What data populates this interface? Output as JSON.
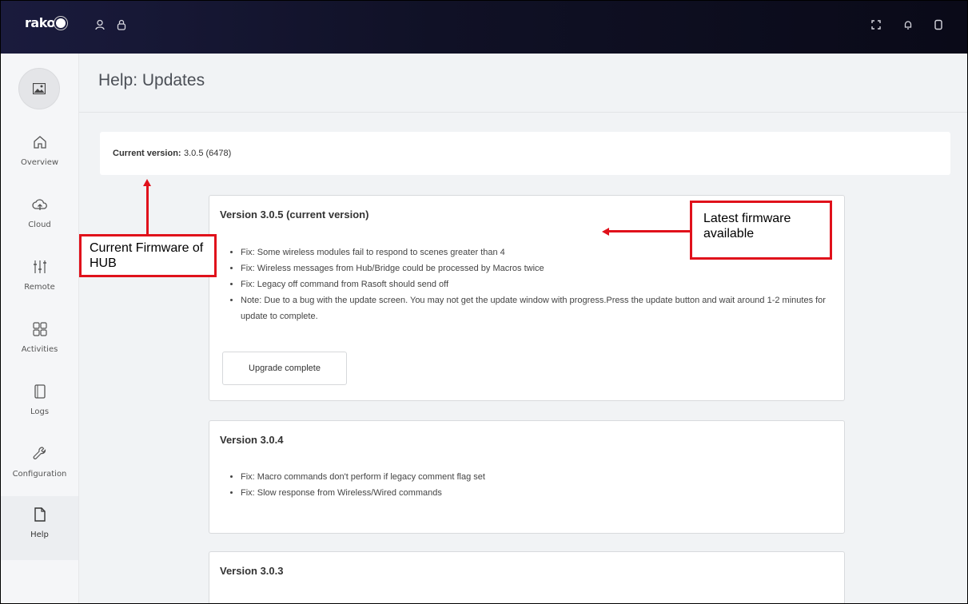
{
  "app": {
    "logo": "rako"
  },
  "topbar": {
    "left_icons": [
      "user-icon",
      "lock-icon"
    ],
    "right_icons": [
      "fullscreen-icon",
      "bell-icon",
      "panel-icon"
    ]
  },
  "sidebar": {
    "items": [
      {
        "label": "Overview",
        "icon": "home-icon"
      },
      {
        "label": "Cloud",
        "icon": "cloud-icon"
      },
      {
        "label": "Remote",
        "icon": "sliders-icon"
      },
      {
        "label": "Activities",
        "icon": "grid-icon"
      },
      {
        "label": "Logs",
        "icon": "logs-icon"
      },
      {
        "label": "Configuration",
        "icon": "wrench-icon"
      },
      {
        "label": "Help",
        "icon": "help-doc-icon",
        "active": true
      }
    ]
  },
  "header": {
    "title": "Help: Updates"
  },
  "current_version": {
    "label": "Current version:",
    "value": "3.0.5 (6478)"
  },
  "releases": [
    {
      "title": "Version 3.0.5 (current version)",
      "notes": [
        "Fix: Some wireless modules fail to respond to scenes greater than 4",
        "Fix: Wireless messages from Hub/Bridge could be processed by Macros twice",
        "Fix: Legacy off command from Rasoft should send off",
        "Note: Due to a bug with the update screen. You may not get the update window with progress.Press the update button and wait around 1-2 minutes for update to complete."
      ],
      "button": "Upgrade complete"
    },
    {
      "title": "Version 3.0.4",
      "notes": [
        "Fix: Macro commands don't perform if legacy comment flag set",
        "Fix: Slow response from Wireless/Wired commands"
      ]
    },
    {
      "title": "Version 3.0.3",
      "notes": []
    }
  ],
  "annotations": {
    "current_firmware": "Current Firmware of HUB",
    "latest_firmware": "Latest firmware available"
  },
  "colors": {
    "topbar": "#101126",
    "annotation": "#e0111b",
    "content_bg": "#f1f3f5"
  }
}
